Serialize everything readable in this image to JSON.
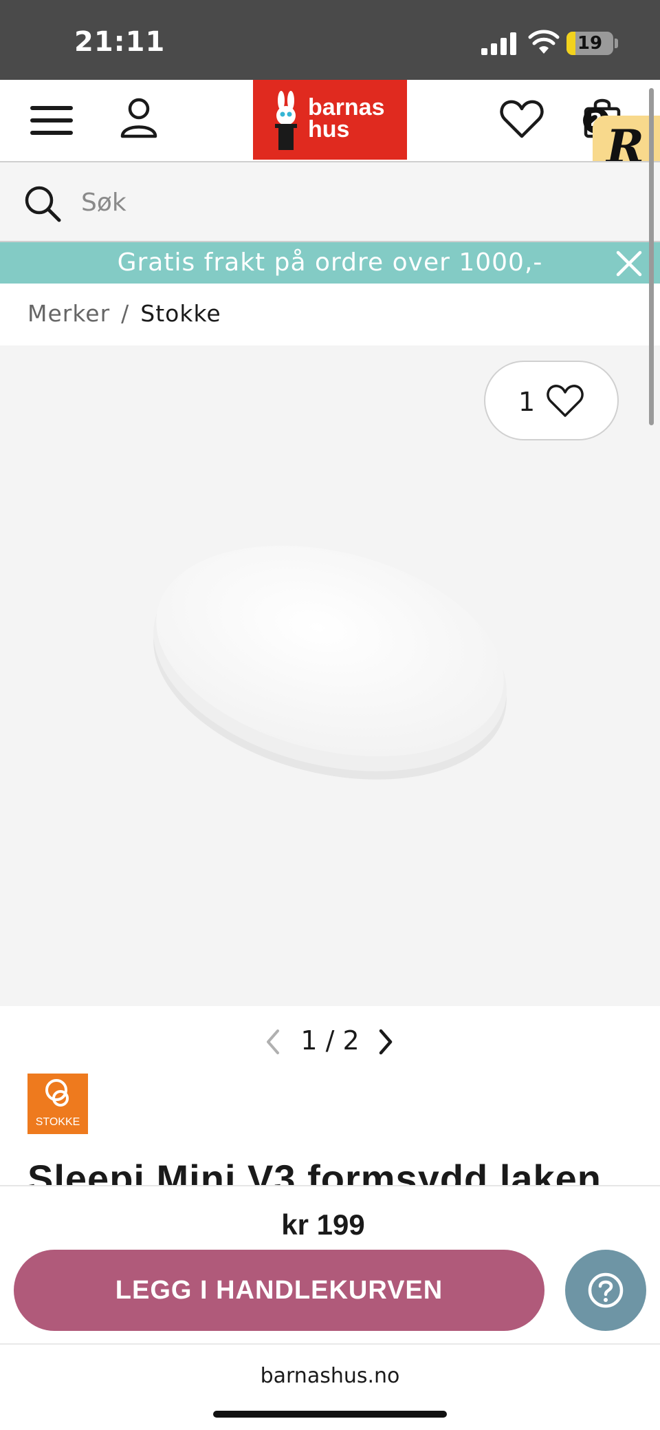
{
  "status_bar": {
    "time": "21:11",
    "battery": "19",
    "battery_level": 0.19
  },
  "header": {
    "logo_text_line1": "barnas",
    "logo_text_line2": "hus",
    "cart_count": "2",
    "r_badge": "R",
    "colors": {
      "logo_bg": "#e02a1f",
      "badge_bg": "#f8d98c"
    }
  },
  "search": {
    "placeholder": "Søk",
    "value": ""
  },
  "promo": {
    "text": "Gratis frakt på ordre over 1000,-",
    "color": "#83cbc5"
  },
  "breadcrumb": {
    "parent": "Merker",
    "separator": "/",
    "current": "Stokke"
  },
  "gallery": {
    "favorites_count": "1",
    "pager_text": "1 / 2"
  },
  "brand": {
    "name": "STOKKE",
    "color": "#ee7a1e"
  },
  "product": {
    "title": "Sleepi Mini V3 formsydd laken",
    "price": "kr 199"
  },
  "buy_bar": {
    "cta_label": "LEGG I HANDLEKURVEN",
    "cta_color": "#b05a7a",
    "help_color": "#6e95a5"
  },
  "browser": {
    "url": "barnashus.no"
  },
  "icons": [
    "menu-icon",
    "user-icon",
    "heart-icon",
    "bag-icon",
    "search-icon",
    "close-icon",
    "chevron-left-icon",
    "chevron-right-icon",
    "question-icon",
    "signal-icon",
    "wifi-icon",
    "battery-icon"
  ]
}
